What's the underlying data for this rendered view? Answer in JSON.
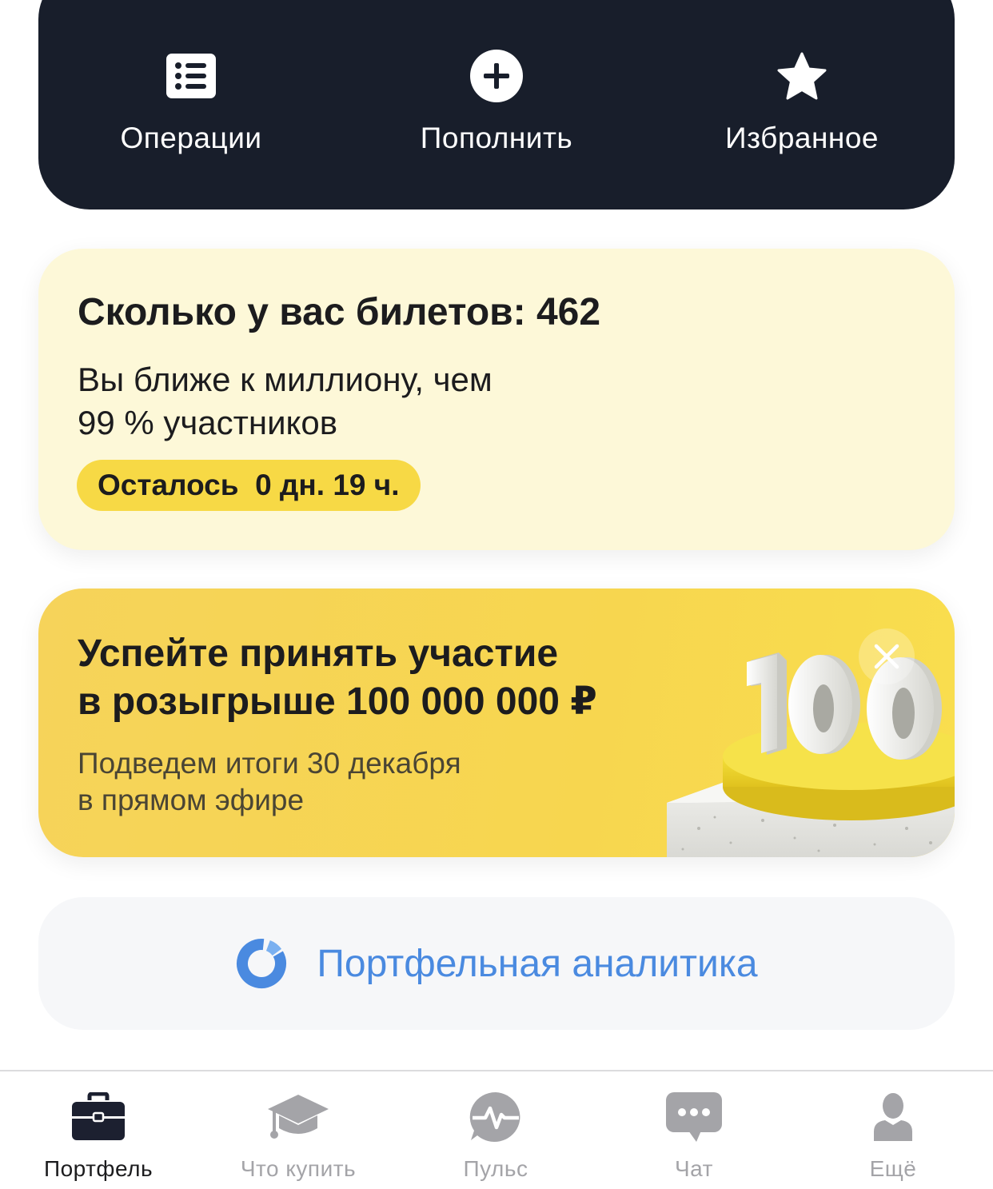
{
  "actions": [
    {
      "label": "Операции",
      "icon": "list-icon"
    },
    {
      "label": "Пополнить",
      "icon": "plus-circle-icon"
    },
    {
      "label": "Избранное",
      "icon": "star-icon"
    }
  ],
  "tickets_card": {
    "title": "Сколько у вас билетов: 462",
    "subtitle_line1": "Вы ближе к миллиону, чем",
    "subtitle_line2": "99 % участников",
    "countdown": "Осталось  0 дн. 19 ч."
  },
  "promo_card": {
    "title_line1": "Успейте принять участие",
    "title_line2": "в розыгрыше 100 000 000 ₽",
    "subtitle_line1": "Подведем итоги 30 декабря",
    "subtitle_line2": "в прямом эфире",
    "art_text": "100",
    "close_icon": "close-icon"
  },
  "analytics": {
    "label": "Портфельная аналитика",
    "icon": "donut-chart-icon",
    "color": "#4a8ae0"
  },
  "tabbar": [
    {
      "label": "Портфель",
      "icon": "briefcase-icon",
      "active": true
    },
    {
      "label": "Что купить",
      "icon": "graduation-cap-icon",
      "active": false
    },
    {
      "label": "Пульс",
      "icon": "pulse-icon",
      "active": false
    },
    {
      "label": "Чат",
      "icon": "chat-icon",
      "active": false
    },
    {
      "label": "Ещё",
      "icon": "profile-icon",
      "active": false
    }
  ],
  "colors": {
    "dark_bar": "#181e2b",
    "tickets_bg": "#fdf8d8",
    "badge_yellow": "#f7d945",
    "promo_yellow": "#f7d64f",
    "inactive_tab": "#a4a4a8"
  }
}
